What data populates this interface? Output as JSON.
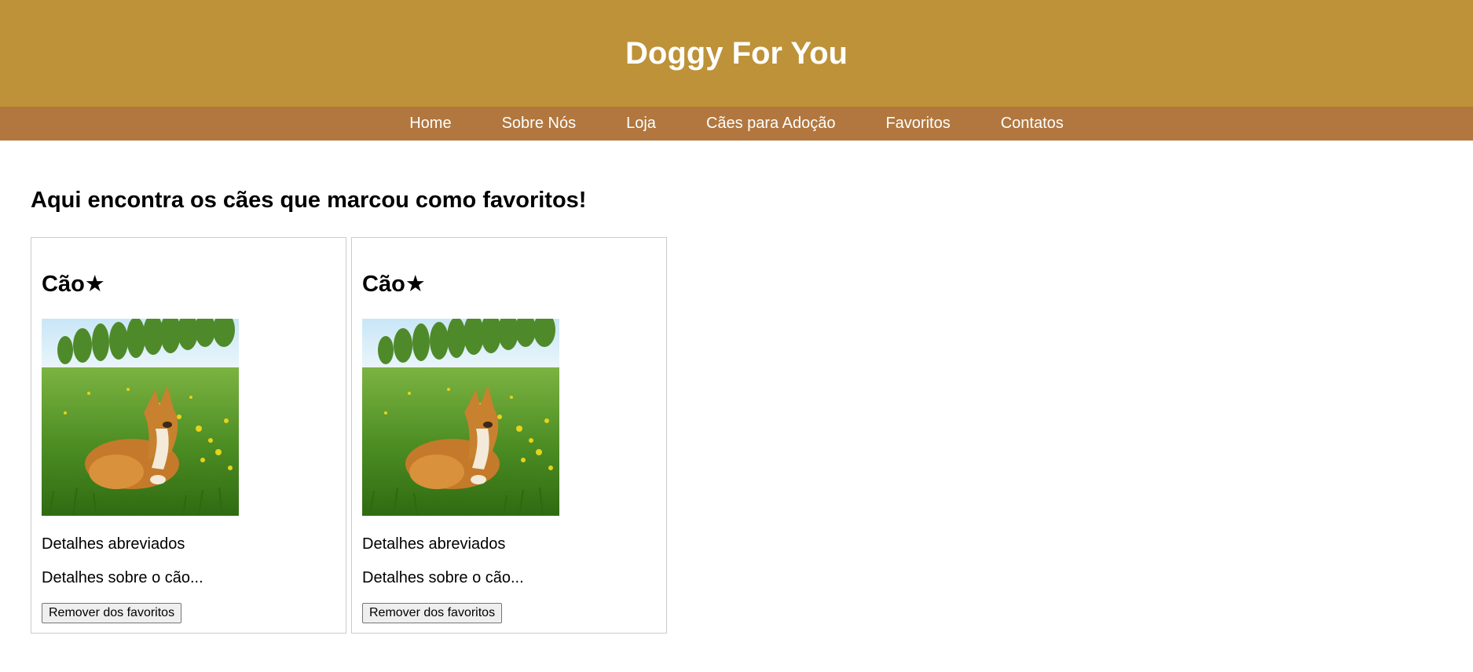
{
  "header": {
    "title": "Doggy For You"
  },
  "nav": {
    "items": [
      {
        "label": "Home"
      },
      {
        "label": "Sobre Nós"
      },
      {
        "label": "Loja"
      },
      {
        "label": "Cães para Adoção"
      },
      {
        "label": "Favoritos"
      },
      {
        "label": "Contatos"
      }
    ]
  },
  "main": {
    "heading": "Aqui encontra os cães que marcou como favoritos!",
    "cards": [
      {
        "title": "Cão★",
        "short_details": "Detalhes abreviados",
        "details": "Detalhes sobre o cão...",
        "remove_label": "Remover dos favoritos",
        "image_icon": "corgi-in-field-photo"
      },
      {
        "title": "Cão★",
        "short_details": "Detalhes abreviados",
        "details": "Detalhes sobre o cão...",
        "remove_label": "Remover dos favoritos",
        "image_icon": "corgi-in-field-photo"
      }
    ]
  },
  "colors": {
    "header_bg": "#bd9238",
    "nav_bg": "#b1773e",
    "header_text": "#ffffff"
  }
}
